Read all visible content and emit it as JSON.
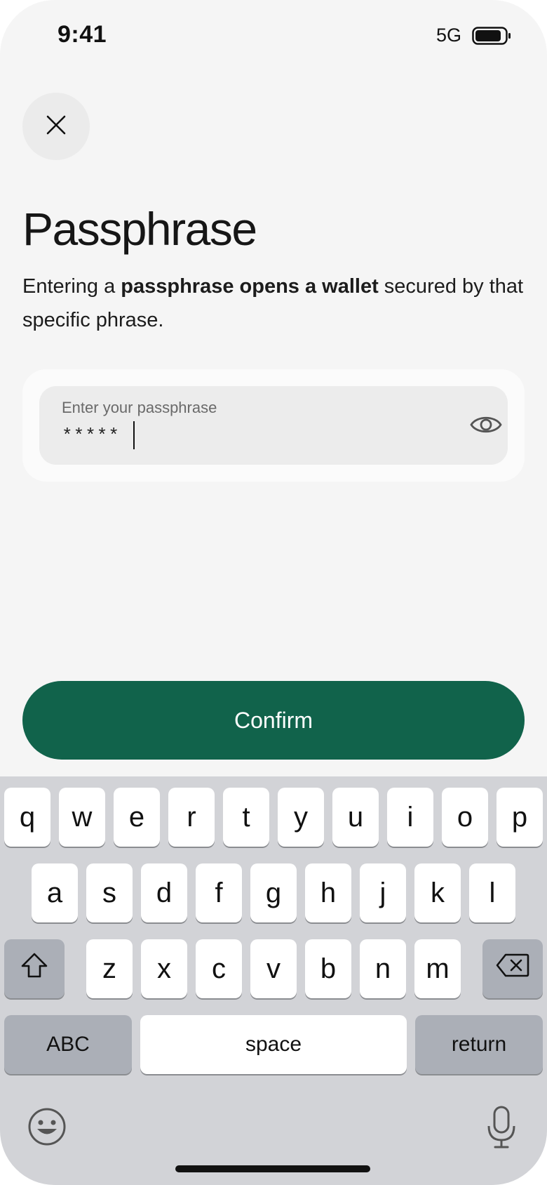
{
  "status_bar": {
    "time": "9:41",
    "network": "5G"
  },
  "header": {
    "title": "Passphrase"
  },
  "description": {
    "prefix": "Entering a ",
    "emphasis": "passphrase opens a wallet",
    "suffix": " secured by that specific phrase."
  },
  "passphrase_field": {
    "label": "Enter your passphrase",
    "value": "*****",
    "visibility_icon": "eye-icon"
  },
  "confirm_button": {
    "label": "Confirm"
  },
  "keyboard": {
    "row1": [
      "q",
      "w",
      "e",
      "r",
      "t",
      "y",
      "u",
      "i",
      "o",
      "p"
    ],
    "row2": [
      "a",
      "s",
      "d",
      "f",
      "g",
      "h",
      "j",
      "k",
      "l"
    ],
    "row3": [
      "z",
      "x",
      "c",
      "v",
      "b",
      "n",
      "m"
    ],
    "abc_label": "ABC",
    "space_label": "space",
    "return_label": "return",
    "icons": {
      "shift": "shift-icon",
      "backspace": "backspace-icon",
      "emoji": "emoji-icon",
      "dictation": "microphone-icon"
    }
  },
  "colors": {
    "accent": "#11634b",
    "background": "#f5f5f5",
    "keyboard": "#d2d3d7"
  }
}
